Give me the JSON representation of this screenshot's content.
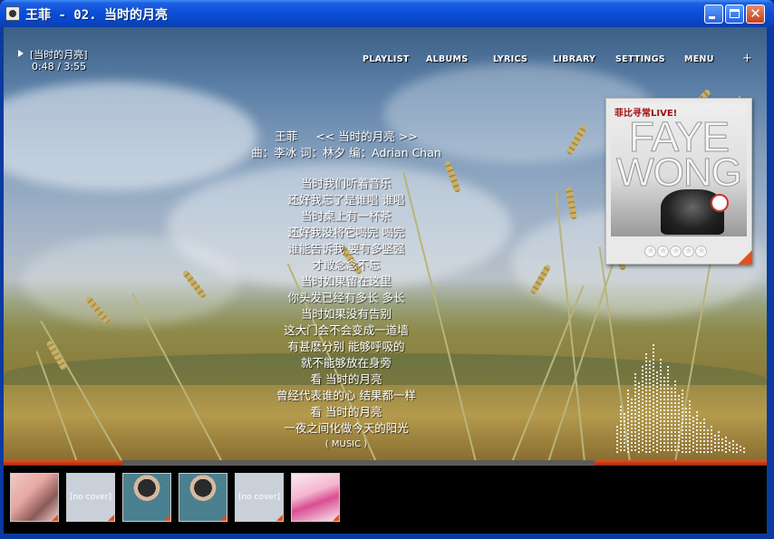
{
  "window": {
    "title": "王菲 - 02. 当时的月亮",
    "buttons": {
      "minimize": "minimize",
      "maximize": "maximize",
      "close": "close"
    }
  },
  "now_playing": {
    "title": "[当时的月亮]",
    "time": "0:48 / 3:55",
    "progress": 0.204
  },
  "nav": [
    "PLAYLIST",
    "ALBUMS",
    "LYRICS",
    "LIBRARY",
    "SETTINGS",
    "MENU",
    "+"
  ],
  "lyrics": {
    "artist": "王菲",
    "song": "<< 当时的月亮 >>",
    "credits": "曲：李冰  词：林夕  编：Adrian Chan",
    "lines": [
      "当时我们听着音乐",
      "还好我忘了是谁唱 谁唱",
      "当时桌上有一杯茶",
      "还好我没将它喝完 喝完",
      "谁能告诉我 要有多坚强",
      "才敢念念不忘",
      "当时如果留在这里",
      "你头发已经有多长 多长",
      "当时如果没有告别",
      "这大门会不会变成一道墙",
      "有甚麽分别 能够呼吸的",
      "就不能够放在身旁",
      "看 当时的月亮",
      "曾经代表谁的心 结果都一样",
      "看 当时的月亮",
      "一夜之间化做今天的阳光",
      "( MUSIC )"
    ]
  },
  "album_cover": {
    "live_text": "菲比寻常LIVE!",
    "artist_line1": "FAYE",
    "artist_line2": "WONG",
    "rating_stars": 5,
    "rating_value": 0
  },
  "thumbnails": [
    {
      "label": "",
      "kind": "cover"
    },
    {
      "label": "[no cover]",
      "kind": "no-cover"
    },
    {
      "label": "",
      "kind": "cover"
    },
    {
      "label": "",
      "kind": "cover"
    },
    {
      "label": "[no cover]",
      "kind": "no-cover"
    },
    {
      "label": "",
      "kind": "cover"
    }
  ],
  "colors": {
    "accent": "#e1511e",
    "titlebar": "#0c4fd8",
    "text": "#ffffff"
  }
}
